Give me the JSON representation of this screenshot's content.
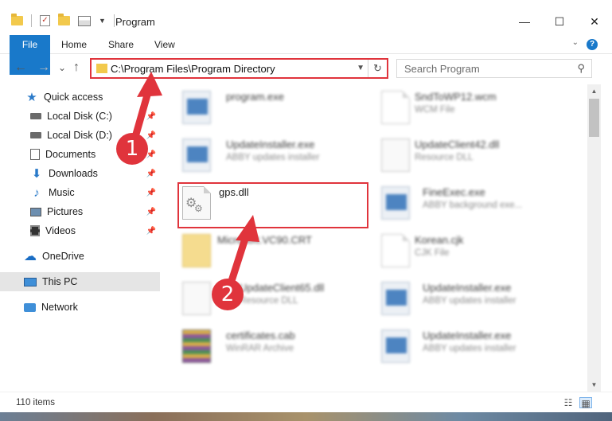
{
  "window": {
    "title": "Program",
    "controls": {
      "minimize": "—",
      "maximize": "☐",
      "close": "✕"
    }
  },
  "ribbon": {
    "tabs": [
      "File",
      "Home",
      "Share",
      "View"
    ],
    "help": "?"
  },
  "nav": {
    "back": "←",
    "forward": "→",
    "recent": "⌄",
    "up": "↑",
    "address": "C:\\Program Files\\Program Directory",
    "refresh": "↻",
    "search_placeholder": "Search Program",
    "search_icon": "⚲"
  },
  "sidebar": {
    "items": [
      {
        "label": "Quick access",
        "icon": "star-icon"
      },
      {
        "label": "Local Disk (C:)",
        "icon": "drive-icon",
        "pinned": true
      },
      {
        "label": "Local Disk (D:)",
        "icon": "drive-icon",
        "pinned": true
      },
      {
        "label": "Documents",
        "icon": "documents-icon",
        "pinned": true
      },
      {
        "label": "Downloads",
        "icon": "download-icon",
        "pinned": true
      },
      {
        "label": "Music",
        "icon": "music-icon",
        "pinned": true
      },
      {
        "label": "Pictures",
        "icon": "pictures-icon",
        "pinned": true
      },
      {
        "label": "Videos",
        "icon": "videos-icon",
        "pinned": true
      },
      {
        "label": "OneDrive",
        "icon": "cloud-icon"
      },
      {
        "label": "This PC",
        "icon": "computer-icon",
        "selected": true
      },
      {
        "label": "Network",
        "icon": "network-icon"
      }
    ]
  },
  "files": {
    "left": [
      {
        "name": "program.exe",
        "desc": "",
        "icon": "app-icon"
      },
      {
        "name": "UpdateInstaller.exe",
        "desc": "ABBY updates installer",
        "icon": "app-icon"
      },
      {
        "name": "gps.dll",
        "desc": "",
        "icon": "dll-icon"
      },
      {
        "name": "Microsoft.VC90.CRT",
        "desc": "",
        "icon": "folder-icon"
      },
      {
        "name": "UpdateClient65.dll",
        "desc": "Resource DLL",
        "icon": "dll-icon"
      },
      {
        "name": "certificates.cab",
        "desc": "WinRAR Archive",
        "icon": "archive-icon"
      }
    ],
    "right": [
      {
        "name": "SndToWP12.wcm",
        "desc": "WCM File",
        "icon": "document-icon"
      },
      {
        "name": "UpdateClient42.dll",
        "desc": "Resource DLL",
        "icon": "dll-icon"
      },
      {
        "name": "FineExec.exe",
        "desc": "ABBY background exe...",
        "icon": "app-icon"
      },
      {
        "name": "Korean.cjk",
        "desc": "CJK File",
        "icon": "document-icon"
      },
      {
        "name": "UpdateInstaller.exe",
        "desc": "ABBY updates installer",
        "icon": "app-icon"
      },
      {
        "name": "UpdateInstaller.exe",
        "desc": "ABBY updates installer",
        "icon": "app-icon"
      }
    ]
  },
  "status": {
    "count": "110 items"
  },
  "annotations": {
    "step1": "1",
    "step2": "2",
    "color": "#e0343c"
  }
}
